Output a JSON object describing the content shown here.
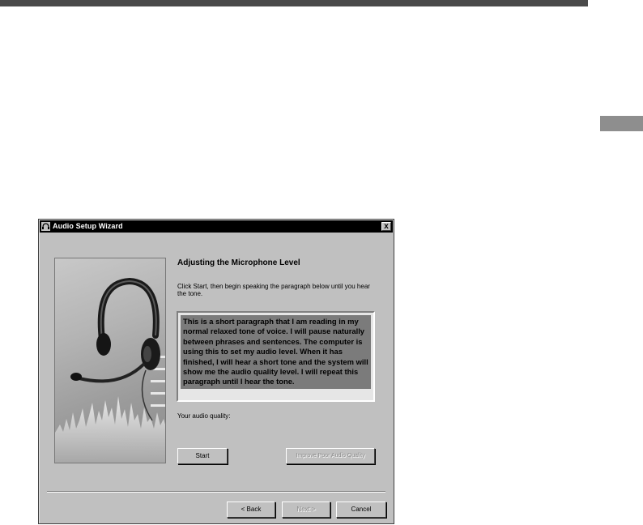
{
  "window": {
    "title": "Audio Setup Wizard",
    "close_label": "x"
  },
  "main": {
    "heading": "Adjusting the Microphone Level",
    "instructions": "Click Start, then begin speaking the paragraph below until you hear the tone.",
    "paragraph": "This is a short paragraph that I am reading in my normal relaxed tone of voice. I will pause naturally between phrases and sentences. The computer is using this to set my audio level. When it has finished, I will hear a short tone and the system will show me the audio quality level. I will repeat this paragraph until I hear the tone.",
    "quality_label": "Your audio quality:"
  },
  "buttons": {
    "start": "Start",
    "improve": "Improve Poor Audio Quality",
    "back": "< Back",
    "next": "Next >",
    "cancel": "Cancel"
  },
  "icons": {
    "app": "microphone-headset-icon",
    "close": "close-icon"
  },
  "colors": {
    "titlebar": "#000000",
    "dialog_face": "#c0c0c0",
    "paragraph_highlight": "#7b7b7b"
  }
}
